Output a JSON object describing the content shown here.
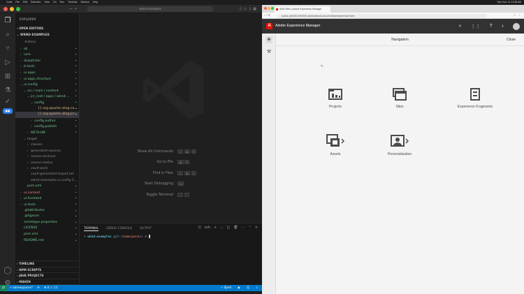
{
  "menubar": {
    "items": [
      "Code",
      "File",
      "Edit",
      "Selection",
      "View",
      "Go",
      "Run",
      "Terminal",
      "Window",
      "Help"
    ],
    "clock": "Mon Nov 14 11:38 AM"
  },
  "vscode": {
    "titlebar": {
      "command_center": "wknd-examples"
    },
    "sidebar": {
      "header": "EXPLORER",
      "open_editors": "OPEN EDITORS",
      "project": "WKND-EXAMPLES",
      "tree": [
        {
          "label": ".history",
          "indent": 1,
          "arrow": "",
          "color": "dim",
          "status": ""
        },
        {
          "label": "all",
          "indent": 1,
          "arrow": "›",
          "color": "green",
          "status": ""
        },
        {
          "label": "core",
          "indent": 1,
          "arrow": "›",
          "color": "green",
          "status": ""
        },
        {
          "label": "dispatcher",
          "indent": 1,
          "arrow": "›",
          "color": "green",
          "status": ""
        },
        {
          "label": "it.tests",
          "indent": 1,
          "arrow": "›",
          "color": "green",
          "status": ""
        },
        {
          "label": "ui.apps",
          "indent": 1,
          "arrow": "›",
          "color": "green",
          "status": ""
        },
        {
          "label": "ui.apps.structure",
          "indent": 1,
          "arrow": "›",
          "color": "green",
          "status": ""
        },
        {
          "label": "ui.config",
          "indent": 1,
          "arrow": "⌄",
          "color": "green",
          "status": ""
        },
        {
          "label": "src / main / content",
          "indent": 2,
          "arrow": "⌄",
          "color": "green",
          "status": ""
        },
        {
          "label": "jcr_root / apps / wknd-...",
          "indent": 3,
          "arrow": "⌄",
          "color": "green",
          "status": ""
        },
        {
          "label": "config",
          "indent": 4,
          "arrow": "⌄",
          "color": "green",
          "status": ""
        },
        {
          "label": "{} org.apache.sling.co...",
          "indent": 5,
          "arrow": "",
          "color": "yellow",
          "status": ""
        },
        {
          "label": "{} org.apache.sling.jcr...",
          "indent": 5,
          "arrow": "",
          "color": "yellow",
          "status": "",
          "selected": true
        },
        {
          "label": "config.author",
          "indent": 4,
          "arrow": "›",
          "color": "green",
          "status": ""
        },
        {
          "label": "config.publish",
          "indent": 4,
          "arrow": "›",
          "color": "green",
          "status": ""
        },
        {
          "label": "META-INF",
          "indent": 3,
          "arrow": "›",
          "color": "green",
          "status": ""
        },
        {
          "label": "target",
          "indent": 2,
          "arrow": "⌄",
          "color": "dim",
          "status": ""
        },
        {
          "label": "classes",
          "indent": 3,
          "arrow": "›",
          "color": "dim",
          "status": ""
        },
        {
          "label": "generated-sources",
          "indent": 3,
          "arrow": "›",
          "color": "dim",
          "status": ""
        },
        {
          "label": "maven-archiver",
          "indent": 3,
          "arrow": "›",
          "color": "dim",
          "status": ""
        },
        {
          "label": "maven-status",
          "indent": 3,
          "arrow": "›",
          "color": "dim",
          "status": ""
        },
        {
          "label": "vault-work",
          "indent": 3,
          "arrow": "›",
          "color": "dim",
          "status": ""
        },
        {
          "label": "vault-generated-import.txt",
          "indent": 3,
          "arrow": "",
          "color": "dim",
          "status": ""
        },
        {
          "label": "wknd-examples.ui.config-1...",
          "indent": 3,
          "arrow": "",
          "color": "dim",
          "status": ""
        },
        {
          "label": "pom.xml",
          "indent": 2,
          "arrow": "",
          "color": "green",
          "status": ""
        },
        {
          "label": "ui.content",
          "indent": 1,
          "arrow": "›",
          "color": "red",
          "status": ""
        },
        {
          "label": "ui.frontend",
          "indent": 1,
          "arrow": "›",
          "color": "green",
          "status": ""
        },
        {
          "label": "ui.tests",
          "indent": 1,
          "arrow": "›",
          "color": "green",
          "status": ""
        },
        {
          "label": ".gitattributes",
          "indent": 1,
          "arrow": "",
          "color": "green",
          "status": ""
        },
        {
          "label": ".gitignore",
          "indent": 1,
          "arrow": "",
          "color": "green",
          "status": ""
        },
        {
          "label": "archetype.properties",
          "indent": 1,
          "arrow": "",
          "color": "green",
          "status": ""
        },
        {
          "label": "LICENSE",
          "indent": 1,
          "arrow": "",
          "color": "green",
          "status": ""
        },
        {
          "label": "pom.xml",
          "indent": 1,
          "arrow": "",
          "color": "green",
          "status": ""
        },
        {
          "label": "README.md",
          "indent": 1,
          "arrow": "",
          "color": "green",
          "status": ""
        }
      ],
      "bottom_sections": [
        "TIMELINE",
        "NPM SCRIPTS",
        "JAVA PROJECTS",
        "MAVEN",
        "LOCAL HISTORY"
      ]
    },
    "editor": {
      "shortcuts": [
        {
          "label": "Show All Commands",
          "keys": [
            "⇧",
            "⌘",
            "P"
          ]
        },
        {
          "label": "Go to File",
          "keys": [
            "⌘",
            "P"
          ]
        },
        {
          "label": "Find in Files",
          "keys": [
            "⇧",
            "⌘",
            "F"
          ]
        },
        {
          "label": "Start Debugging",
          "keys": [
            "F5"
          ]
        },
        {
          "label": "Toggle Terminal",
          "keys": [
            "⌃",
            "`"
          ]
        }
      ]
    },
    "panel": {
      "tabs": [
        "TERMINAL",
        "DEBUG CONSOLE",
        "OUTPUT"
      ],
      "shell": "zsh",
      "prompt": {
        "arrow": "➜",
        "dir": "wknd-examples",
        "git": "git:(",
        "branch": "namespaces",
        "git_close": ")",
        "x": "✗"
      }
    },
    "statusbar": {
      "branch": "namespaces*",
      "problems": "⊗ 0 ⚠ 11",
      "spell": "Spell"
    }
  },
  "browser": {
    "tab_title": "AEM Sites | Adobe Experience Manager",
    "url": "author-p00000-e000000.adobeaemcloud.com/ui#/aem/aem/start.html",
    "aem": {
      "product": "Adobe Experience Manager",
      "logo_letter": "A",
      "nav_title": "Navigation",
      "close": "Close",
      "tiles": [
        {
          "label": "Projects",
          "icon": "projects-icon"
        },
        {
          "label": "Sites",
          "icon": "sites-icon"
        },
        {
          "label": "Experience Fragments",
          "icon": "experience-fragments-icon"
        },
        {
          "label": "Assets",
          "icon": "assets-icon"
        },
        {
          "label": "Personalization",
          "icon": "personalization-icon"
        }
      ]
    }
  },
  "colors": {
    "vscode_bg": "#1e1e1e",
    "statusbar": "#007acc",
    "git_added": "#73c991",
    "git_modified": "#e2c08d",
    "aem_header": "#323232",
    "adobe_red": "#eb1000"
  }
}
